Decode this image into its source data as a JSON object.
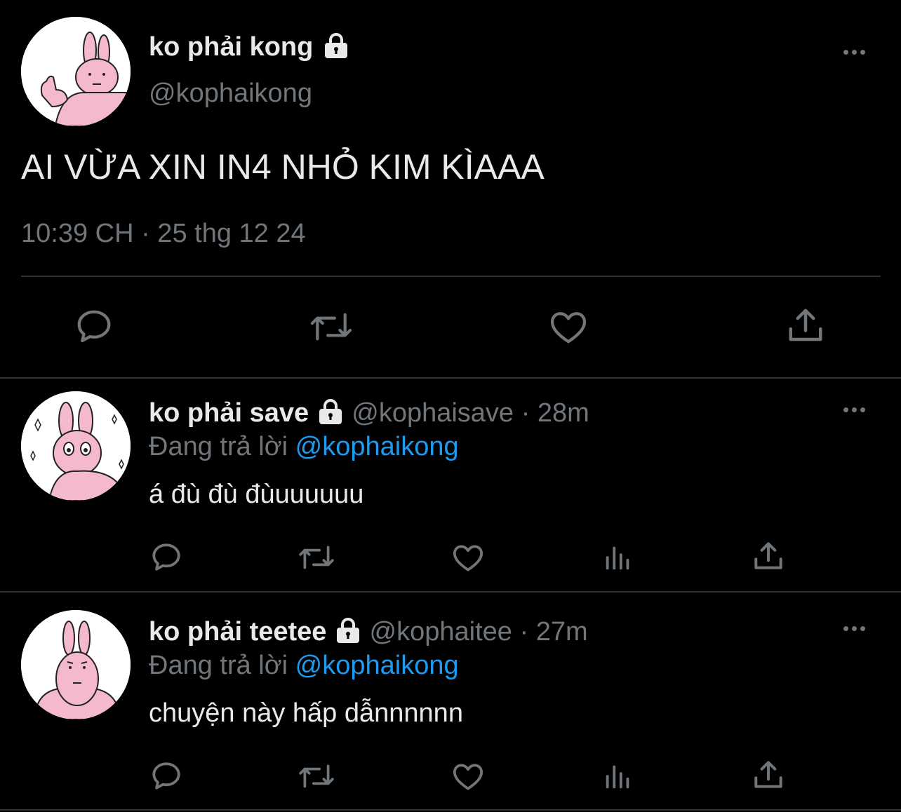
{
  "main_tweet": {
    "display_name": "ko phải kong",
    "handle": "@kophaikong",
    "text": "AI VỪA XIN IN4 NHỎ KIM KÌAAA",
    "timestamp": "10:39 CH · 25 thg 12 24",
    "actions": [
      "reply-icon",
      "retweet-icon",
      "like-icon",
      "share-icon"
    ]
  },
  "replies": [
    {
      "display_name": "ko phải save",
      "handle": "@kophaisave",
      "time": "· 28m",
      "replying_prefix": "Đang trả lời",
      "replying_to": "@kophaikong",
      "text": "á đù đù đùuuuuuu"
    },
    {
      "display_name": "ko phải teetee",
      "handle": "@kophaitee",
      "time": "· 27m",
      "replying_prefix": "Đang trả lời",
      "replying_to": "@kophaikong",
      "text": "chuyện này hấp dẫnnnnnn"
    }
  ],
  "colors": {
    "background": "#000000",
    "text": "#e7e9ea",
    "secondary": "#71767b",
    "link": "#1d9bf0",
    "avatar_pink": "#f4b8cf"
  }
}
